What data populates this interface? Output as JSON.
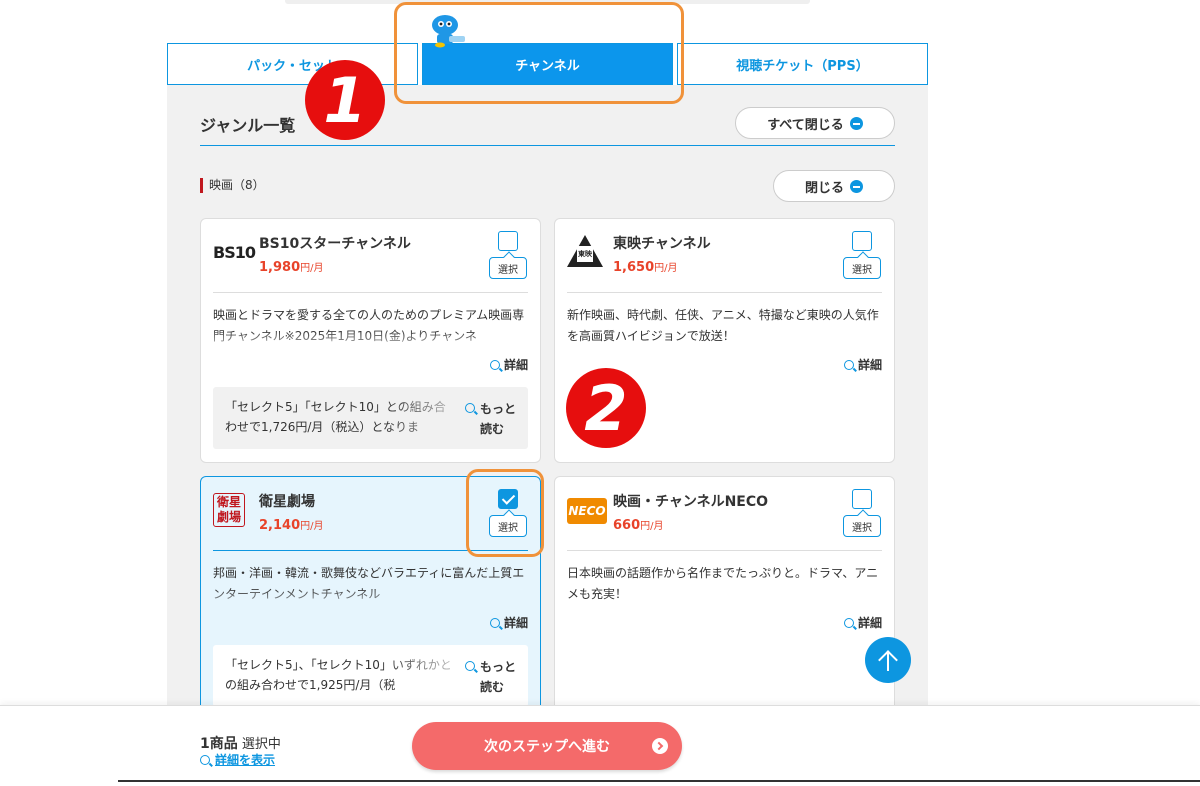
{
  "tabs": [
    {
      "label": "パック・セット",
      "active": false
    },
    {
      "label": "チャンネル",
      "active": true
    },
    {
      "label": "視聴チケット（PPS）",
      "active": false
    }
  ],
  "annotations": {
    "badge1": "1",
    "badge2": "2"
  },
  "genre": {
    "title": "ジャンル一覧",
    "close_all_label": "すべて閉じる"
  },
  "category": {
    "label": "映画（8）",
    "close_label": "閉じる"
  },
  "cards": [
    {
      "name": "BS10スターチャンネル",
      "price": "1,980",
      "unit": "円/月",
      "selected": false,
      "logo_text": "BS10",
      "select_label": "選択",
      "description": "映画とドラマを愛する全ての人のためのプレミアム映画専門チャンネル※2025年1月10日(金)よりチャンネ",
      "detail_label": "詳細",
      "note": "「セレクト5」「セレクト10」との組み合わせで1,726円/月（税込）となりま",
      "more_label": "もっと\n読む"
    },
    {
      "name": "東映チャンネル",
      "price": "1,650",
      "unit": "円/月",
      "selected": false,
      "logo_text": "東映",
      "select_label": "選択",
      "description": "新作映画、時代劇、任侠、アニメ、特撮など東映の人気作を高画質ハイビジョンで放送！",
      "detail_label": "詳細"
    },
    {
      "name": "衛星劇場",
      "price": "2,140",
      "unit": "円/月",
      "selected": true,
      "logo_text": "衛星\n劇場",
      "select_label": "選択",
      "description": "邦画・洋画・韓流・歌舞伎などバラエティに富んだ上質エンターテインメントチャンネル",
      "detail_label": "詳細",
      "note": "「セレクト5」、「セレクト10」いずれかとの組み合わせで1,925円/月（税",
      "more_label": "もっと\n読む"
    },
    {
      "name": "映画・チャンネルNECO",
      "price": "660",
      "unit": "円/月",
      "selected": false,
      "logo_text": "NECO",
      "select_label": "選択",
      "description": "日本映画の話題作から名作までたっぷりと。ドラマ、アニメも充実！",
      "detail_label": "詳細"
    }
  ],
  "footer": {
    "count_number": "1",
    "count_unit": "商品",
    "count_status": "選択中",
    "show_detail_label": "詳細を表示",
    "next_label": "次のステップへ進む"
  },
  "colors": {
    "accent": "#0d96e0",
    "price": "#e8432a",
    "next_button": "#f46a6a",
    "highlight": "#f0923a",
    "badge": "#e60e0e"
  },
  "icons": [
    "mascot-icon",
    "minus-circle-icon",
    "zoom-icon",
    "check-icon",
    "arrow-up-icon",
    "chevron-right-icon"
  ]
}
